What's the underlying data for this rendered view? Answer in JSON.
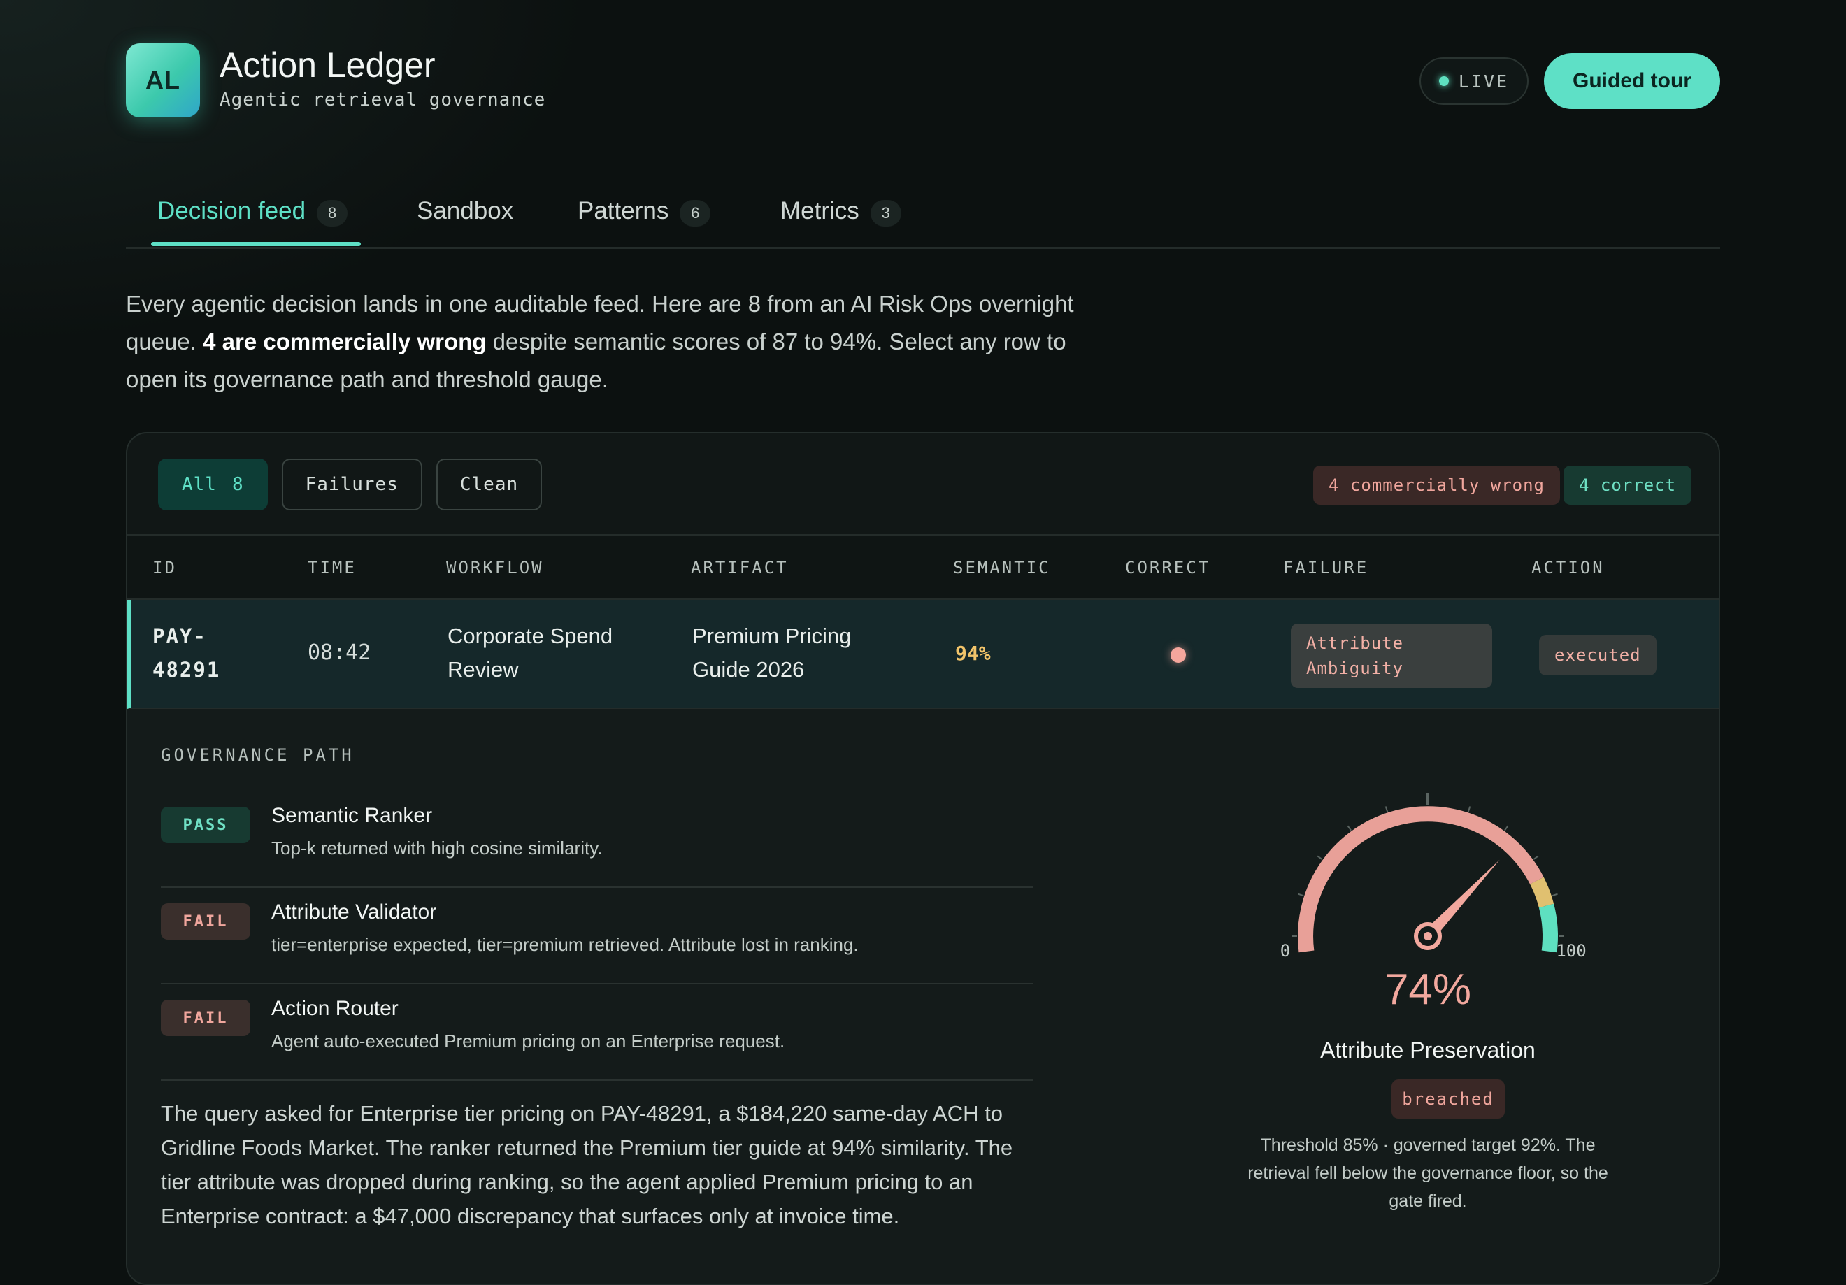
{
  "app": {
    "logo_initials": "AL",
    "title": "Action Ledger",
    "subtitle": "Agentic retrieval governance",
    "live_label": "LIVE",
    "tour_button": "Guided tour"
  },
  "tabs": [
    {
      "label": "Decision feed",
      "count": "8",
      "active": true
    },
    {
      "label": "Sandbox",
      "count": null,
      "active": false
    },
    {
      "label": "Patterns",
      "count": "6",
      "active": false
    },
    {
      "label": "Metrics",
      "count": "3",
      "active": false
    }
  ],
  "intro": {
    "part1": "Every agentic decision lands in one auditable feed. Here are 8 from an AI Risk Ops overnight queue. ",
    "emphasis": "4 are commercially wrong",
    "part2": " despite semantic scores of 87 to 94%. Select any row to open its governance path and threshold gauge."
  },
  "filters": {
    "all_label": "All",
    "all_count": "8",
    "failures_label": "Failures",
    "clean_label": "Clean"
  },
  "summary": {
    "wrong": "4 commercially wrong",
    "correct": "4 correct"
  },
  "table": {
    "headers": [
      "ID",
      "TIME",
      "WORKFLOW",
      "ARTIFACT",
      "SEMANTIC",
      "CORRECT",
      "FAILURE",
      "ACTION"
    ],
    "selected_row": {
      "id_line1": "PAY-",
      "id_line2": "48291",
      "time": "08:42",
      "workflow_line1": "Corporate Spend",
      "workflow_line2": "Review",
      "artifact_line1": "Premium Pricing",
      "artifact_line2": "Guide 2026",
      "semantic": "94%",
      "correct": false,
      "failure_line1": "Attribute",
      "failure_line2": "Ambiguity",
      "action": "executed"
    }
  },
  "governance": {
    "label": "GOVERNANCE PATH",
    "steps": [
      {
        "status": "PASS",
        "title": "Semantic Ranker",
        "desc": "Top-k returned with high cosine similarity."
      },
      {
        "status": "FAIL",
        "title": "Attribute Validator",
        "desc": "tier=enterprise expected, tier=premium retrieved. Attribute lost in ranking."
      },
      {
        "status": "FAIL",
        "title": "Action Router",
        "desc": "Agent auto-executed Premium pricing on an Enterprise request."
      }
    ],
    "narrative": "The query asked for Enterprise tier pricing on PAY-48291, a $184,220 same-day ACH to Gridline Foods Market. The ranker returned the Premium tier guide at 94% similarity. The tier attribute was dropped during ranking, so the agent applied Premium pricing to an Enterprise contract: a $47,000 discrepancy that surfaces only at invoice time."
  },
  "gauge": {
    "value": 74,
    "value_label": "74%",
    "min_label": "0",
    "max_label": "100",
    "threshold": 85,
    "target": 92,
    "metric": "Attribute Preservation",
    "status": "breached",
    "note": "Threshold 85% · governed target 92%. The retrieval fell below the governance floor, so the gate fired.",
    "colors": {
      "breach": "#e8a098",
      "warn": "#e0c070",
      "ok": "#5ee0c0",
      "needle": "#f2a89e"
    }
  }
}
